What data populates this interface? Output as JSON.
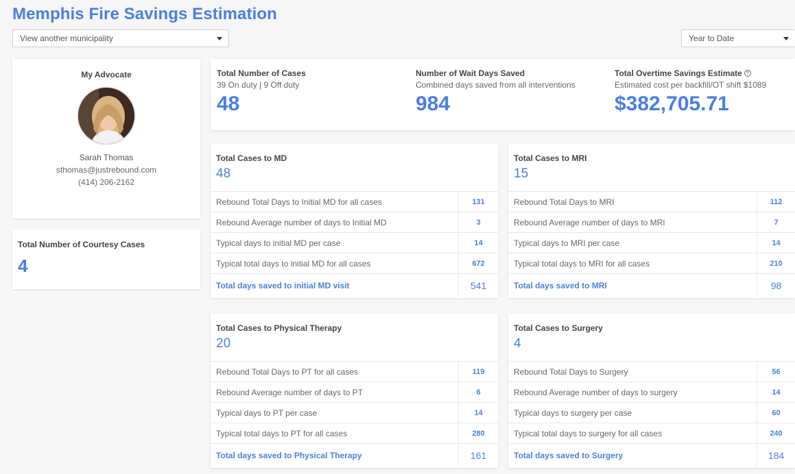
{
  "page": {
    "title": "Memphis Fire Savings Estimation"
  },
  "filters": {
    "municipality": "View another municipality",
    "period": "Year to Date"
  },
  "advocate": {
    "title": "My Advocate",
    "name": "Sarah Thomas",
    "email": "sthomas@justrebound.com",
    "phone": "(414) 206-2162"
  },
  "courtesy": {
    "label": "Total Number of Courtesy Cases",
    "value": "4"
  },
  "summary": {
    "cases": {
      "title": "Total Number of Cases",
      "sub": "39 On duty | 9 Off duty",
      "value": "48"
    },
    "wait_days": {
      "title": "Number of Wait Days Saved",
      "sub": "Combined days saved from all interventions",
      "value": "984"
    },
    "overtime": {
      "title": "Total Overtime Savings Estimate",
      "help_icon": "question-circle-icon",
      "sub": "Estimated cost per backfill/OT shift $1089",
      "value": "$382,705.71"
    }
  },
  "md": {
    "title": "Total Cases to MD",
    "count": "48",
    "rows": [
      {
        "label": "Rebound Total Days to Initial MD for all cases",
        "value": "131"
      },
      {
        "label": "Rebound Average number of days to Initial MD",
        "value": "3"
      },
      {
        "label": "Typical days to initial MD per case",
        "value": "14"
      },
      {
        "label": "Typical total days to initial MD for all cases",
        "value": "672"
      },
      {
        "label": "Total days saved to initial MD visit",
        "value": "541"
      }
    ]
  },
  "mri": {
    "title": "Total Cases to MRI",
    "count": "15",
    "rows": [
      {
        "label": "Rebound Total Days to MRI",
        "value": "112"
      },
      {
        "label": "Rebound Average number of days to MRI",
        "value": "7"
      },
      {
        "label": "Typical days to MRI per case",
        "value": "14"
      },
      {
        "label": "Typical total days to MRI for all cases",
        "value": "210"
      },
      {
        "label": "Total days saved to MRI",
        "value": "98"
      }
    ]
  },
  "pt": {
    "title": "Total Cases to Physical Therapy",
    "count": "20",
    "rows": [
      {
        "label": "Rebound Total Days to PT for all cases",
        "value": "119"
      },
      {
        "label": "Rebound Average number of days to PT",
        "value": "6"
      },
      {
        "label": "Typical days to PT per case",
        "value": "14"
      },
      {
        "label": "Typical total days to PT for all cases",
        "value": "280"
      },
      {
        "label": "Total days saved to Physical Therapy",
        "value": "161"
      }
    ]
  },
  "surgery": {
    "title": "Total Cases to Surgery",
    "count": "4",
    "rows": [
      {
        "label": "Rebound Total Days to Surgery",
        "value": "56"
      },
      {
        "label": "Rebound Average number of days to surgery",
        "value": "14"
      },
      {
        "label": "Typical days to surgery per case",
        "value": "60"
      },
      {
        "label": "Typical total days to surgery for all cases",
        "value": "240"
      },
      {
        "label": "Total days saved to Surgery",
        "value": "184"
      }
    ]
  },
  "colors": {
    "accent": "#4a7fe0",
    "background": "#f6f6f6"
  }
}
